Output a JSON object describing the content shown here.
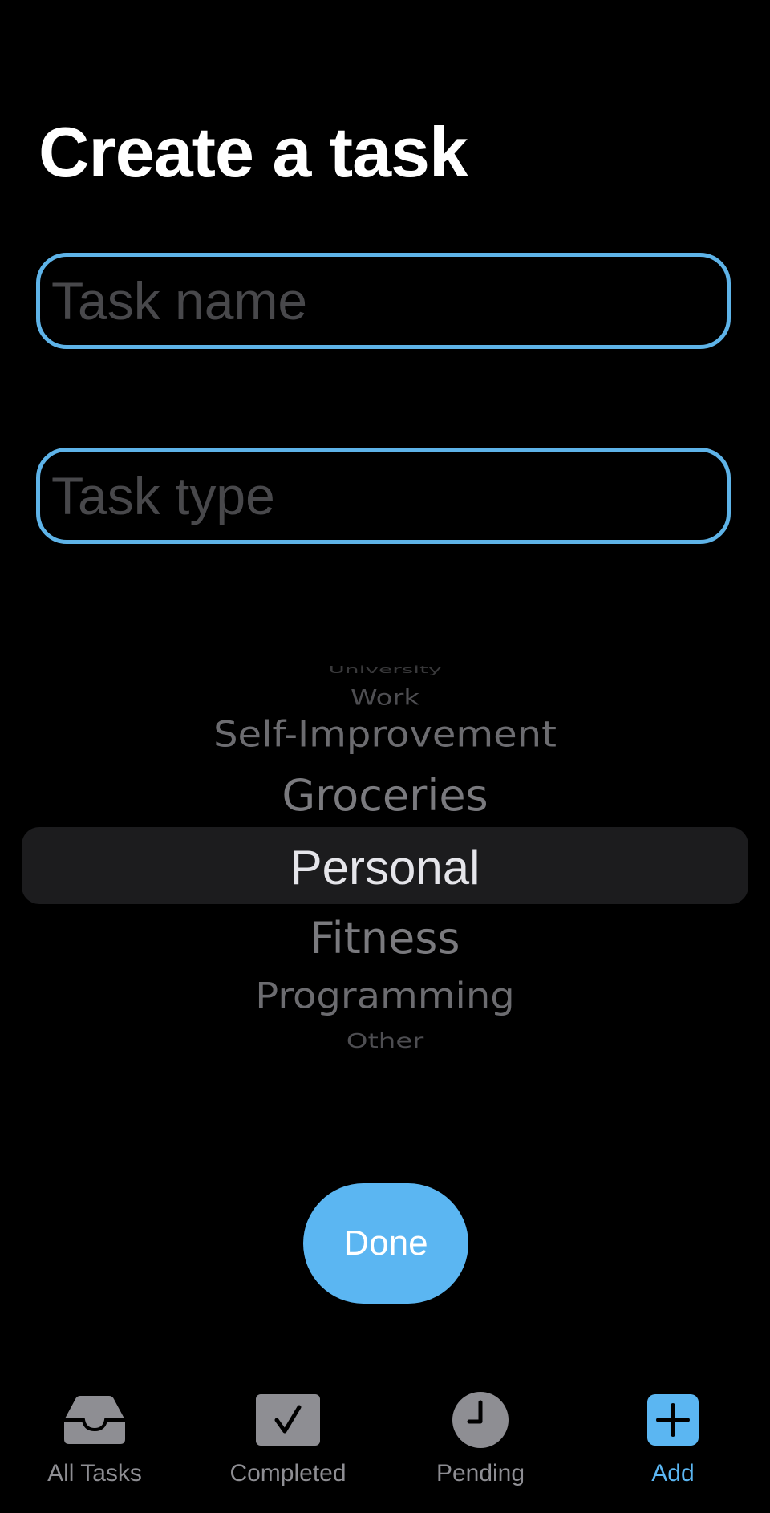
{
  "page": {
    "title": "Create a task"
  },
  "form": {
    "task_name": {
      "value": "",
      "placeholder": "Task name"
    },
    "task_type": {
      "value": "",
      "placeholder": "Task type"
    }
  },
  "picker": {
    "options": [
      "University",
      "Work",
      "Self-Improvement",
      "Groceries",
      "Personal",
      "Fitness",
      "Programming",
      "Other"
    ],
    "selected": "Personal"
  },
  "actions": {
    "done_label": "Done"
  },
  "tab_bar": {
    "tabs": [
      {
        "label": "All Tasks",
        "icon": "tray-icon",
        "active": false
      },
      {
        "label": "Completed",
        "icon": "checkmark-square-icon",
        "active": false
      },
      {
        "label": "Pending",
        "icon": "clock-icon",
        "active": false
      },
      {
        "label": "Add",
        "icon": "plus-square-icon",
        "active": true
      }
    ]
  },
  "colors": {
    "accent": "#5bb6f2",
    "field_border": "#5eb3e8",
    "inactive_icon": "#8e8e93",
    "background": "#000000",
    "picker_highlight": "#1c1c1e"
  }
}
